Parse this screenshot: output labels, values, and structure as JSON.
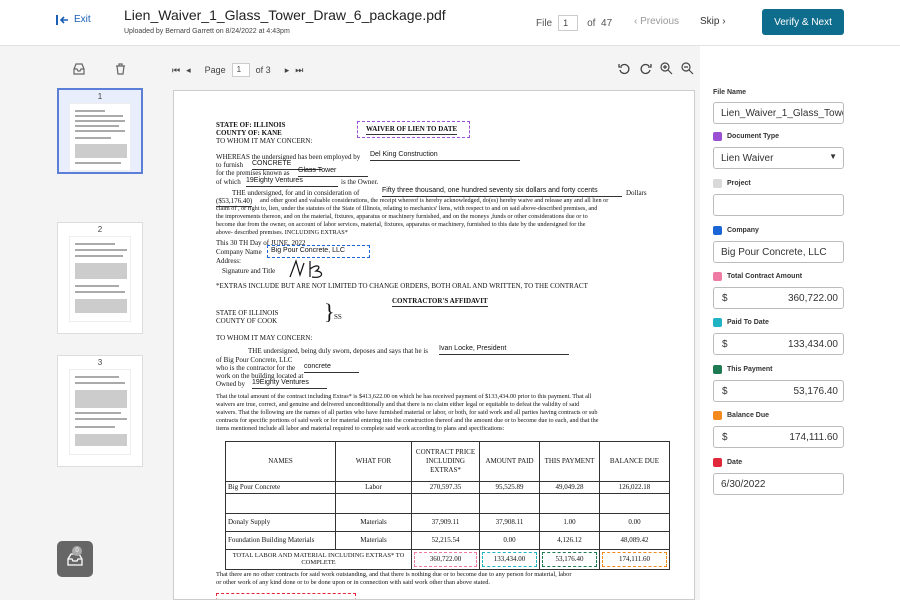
{
  "header": {
    "exit_label": "Exit",
    "file_name": "Lien_Waiver_1_Glass_Tower_Draw_6_package.pdf",
    "uploaded_text": "Uploaded by Bernard Garrett on 8/24/2022 at 4:43pm",
    "file_label": "File",
    "file_current": "1",
    "file_of": "of",
    "file_total": "47",
    "previous_label": "Previous",
    "skip_label": "Skip",
    "verify_label": "Verify & Next"
  },
  "thumbnails": [
    {
      "number": "1"
    },
    {
      "number": "2"
    },
    {
      "number": "3"
    }
  ],
  "inbox_badge": "0",
  "viewer": {
    "page_label": "Page",
    "page_current": "1",
    "page_of": "of 3"
  },
  "document": {
    "state": "STATE OF: ILLINOIS",
    "county": "COUNTY OF: KANE",
    "to_whom": "TO WHOM IT MAY CONCERN:",
    "waiver_title": "WAIVER OF LIEN TO DATE",
    "whereas": "WHEREAS the undersigned has been employed by",
    "employer": "Del King Construction",
    "furnish": "to furnish",
    "furnish_val": "CONCRETE",
    "premises": "for the premises known as",
    "premises_val": "Glass Tower",
    "of_which": "of which",
    "owner_val": "19Eighty Ventures",
    "is_owner": "is the Owner.",
    "consideration_prefix": "THE undersigned, for and in consideration of",
    "consideration_val": "Fifty three thousand, one hundred seventy six dollars and forty ccents",
    "dollars": "Dollars",
    "amount_prefix": "($53,176.40)",
    "body_1": "and other good and valuable considerations, the receipt whereof is hereby acknowledged, do(es) hereby waive and release any and all lien or",
    "body_2": "claim of , or right to, lien, under the statutes of the State of Illinois, relating to mechanics' liens, with respect to and on said above-described premises, and",
    "body_3": "the improvements thereon, and on the material, fixtures, apparatus or machinery furnished, and on the moneys ,funds or other considerations due or to",
    "body_4": "become due from the owner, on account of labor services, material, fixtures, apparatus or machinery, furnished to this date by the undersigned for the",
    "body_5": "above- described premises. INCLUDING EXTRAS*",
    "this_day": "This     30 TH  Day of  JUNE, 2022",
    "company_label": "Company Name",
    "company_val": "Big Pour Concrete, LLC",
    "address_label": "Address:",
    "signature_label": "Signature and Title",
    "extras_note": "*EXTRAS INCLUDE BUT ARE NOT LIMITED TO CHANGE ORDERS, BOTH ORAL AND WRITTEN, TO THE CONTRACT",
    "affidavit_title": "CONTRACTOR'S AFFIDAVIT",
    "aff_state": "STATE OF ILLINOIS",
    "aff_county": "COUNTY OF COOK",
    "aff_ss": "SS",
    "aff_to_whom": "TO WHOM IT MAY CONCERN:",
    "sworn": "THE undersigned, being duly sworn, deposes and says that he is",
    "sworn_val": "Ivan Locke, President",
    "of_co": "of  Big Pour Concrete, LLC",
    "contractor_for": "who is the contractor for the",
    "contractor_val": "concrete",
    "work_on": "work on the building located at",
    "owned_by": "Owned by",
    "owned_val": "19Eighty Ventures",
    "para_1": "That the total amount of the contract including Extras* is $413,622.00 on which he has received payment of $133,434.00 prior to this payment.  That all",
    "para_2": "waivers are true, correct, and genuine and delivered unconditionally and that there is no claim either legal or equitable to defeat the validity of said",
    "para_3": "waivers.  That the following are the names of all parties who have furnished material or labor, or both, for said work and all parties having contracts or sub",
    "para_4": "contracts for specific portions of said work or for material entering into the construction thereof and the amount due or to become due to each, and that the",
    "para_5": "items mentioned include all labor and material required to complete said work according to plans and specifications:",
    "table": {
      "headers": [
        "NAMES",
        "WHAT FOR",
        "CONTRACT PRICE INCLUDING EXTRAS*",
        "AMOUNT PAID",
        "THIS PAYMENT",
        "BALANCE DUE"
      ],
      "rows": [
        [
          "Big Pour Concrete",
          "Labor",
          "270,597.35",
          "95,525.89",
          "49,049.28",
          "126,022.18"
        ],
        [
          "",
          "",
          "",
          "",
          "",
          ""
        ],
        [
          "Donaly Supply",
          "Materials",
          "37,909.11",
          "37,908.11",
          "1.00",
          "0.00"
        ],
        [
          "Foundation Building Materials",
          "Materials",
          "52,215.54",
          "0.00",
          "4,126.12",
          "48,089.42"
        ]
      ],
      "total_label": "TOTAL LABOR AND MATERIAL INCLUDING EXTRAS* TO COMPLETE",
      "total_values": [
        "360,722.00",
        "133,434.00",
        "53,176.40",
        "174,111.60"
      ]
    },
    "closing_1": "That there are no other contracts for said work outstanding, and that there is nothing due or to become due to any person for material, labor",
    "closing_2": "or other work of any kind done or to be done upon or in connection with said work other than above stated."
  },
  "fields": [
    {
      "label": "File Name",
      "color": "",
      "value": "Lien_Waiver_1_Glass_Tower_Draw_6_package.pdf",
      "kind": "text"
    },
    {
      "label": "Document Type",
      "color": "#9b4fd3",
      "value": "Lien Waiver",
      "kind": "select"
    },
    {
      "label": "Project",
      "color": "#d9d9d9",
      "value": "",
      "kind": "text"
    },
    {
      "label": "Company",
      "color": "#1b66d6",
      "value": "Big Pour Concrete, LLC",
      "kind": "text"
    },
    {
      "label": "Total Contract Amount",
      "color": "#ef7aa4",
      "value": "360,722.00",
      "kind": "money"
    },
    {
      "label": "Paid To Date",
      "color": "#1fb3c4",
      "value": "133,434.00",
      "kind": "money"
    },
    {
      "label": "This Payment",
      "color": "#1e7a52",
      "value": "53,176.40",
      "kind": "money"
    },
    {
      "label": "Balance Due",
      "color": "#f28a1e",
      "value": "174,111.60",
      "kind": "money"
    },
    {
      "label": "Date",
      "color": "#e0283a",
      "value": "6/30/2022",
      "kind": "text"
    }
  ],
  "currency_symbol": "$"
}
